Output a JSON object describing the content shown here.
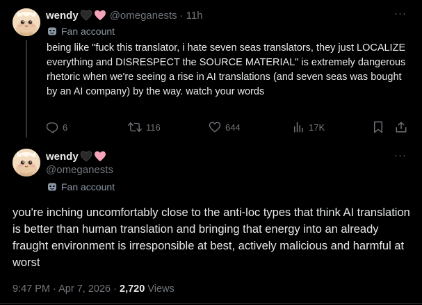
{
  "tweet1": {
    "display_name": "wendy",
    "name_emojis": [
      "black-heart-icon",
      "pink-heart-icon"
    ],
    "handle": "@omeganests",
    "separator": "·",
    "time": "11h",
    "fan_label": "Fan account",
    "body": "being like \"fuck this translator, i hate seven seas translators, they just LOCALIZE everything and DISRESPECT the SOURCE MATERIAL\" is extremely dangerous rhetoric when we're seeing a rise in AI translations (and seven seas was bought by an AI company) by the way. watch your words",
    "more_label": "···",
    "actions": {
      "replies": "6",
      "reposts": "116",
      "likes": "644",
      "views": "17K"
    }
  },
  "tweet2": {
    "display_name": "wendy",
    "name_emojis": [
      "black-heart-icon",
      "pink-heart-icon"
    ],
    "handle": "@omeganests",
    "fan_label": "Fan account",
    "more_label": "···",
    "body": "you're inching uncomfortably close to the anti-loc types that think AI translation is better than human translation and bringing that energy into an already fraught environment is irresponsible at best, actively malicious and harmful at worst",
    "time": "9:47 PM",
    "separator": "·",
    "date": "Apr 7, 2026",
    "views_count": "2,720",
    "views_label": "Views"
  },
  "colors": {
    "background": "#000000",
    "text": "#e7e9ea",
    "muted": "#71767b",
    "pink_heart": "#f4a3b8",
    "black_heart": "#2a2a2a"
  }
}
